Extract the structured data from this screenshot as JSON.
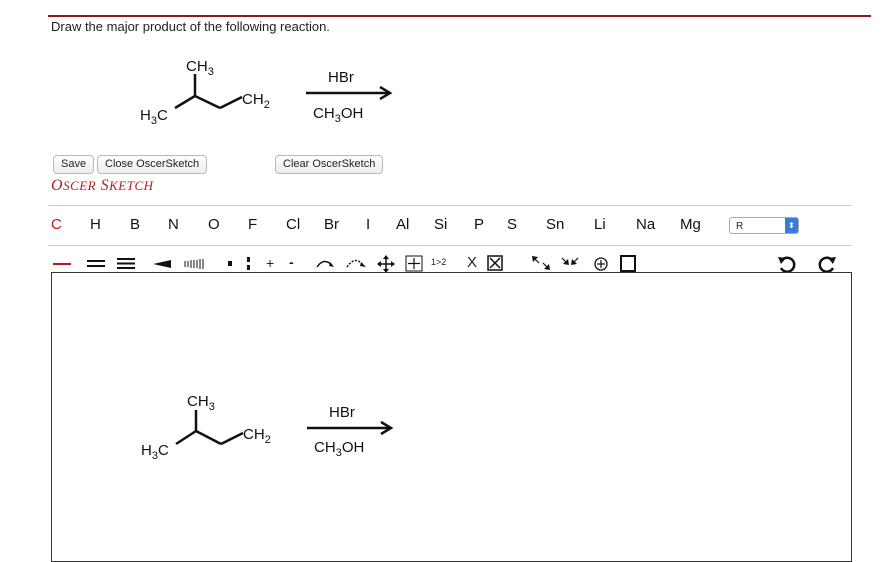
{
  "question": "Draw the major product of the following reaction.",
  "reaction": {
    "top_methyl": "CH3",
    "left_methyl": "H3C",
    "alkene_carbon": "CH2",
    "reagent_top": "HBr",
    "reagent_bottom": "CH3OH"
  },
  "buttons": {
    "save": "Save",
    "close": "Close OscerSketch",
    "clear": "Clear OscerSketch"
  },
  "brand": {
    "first_letter": "O",
    "first_rest": "SCER",
    "second_letter": "S",
    "second_rest": "KETCH"
  },
  "elements": [
    "C",
    "H",
    "B",
    "N",
    "O",
    "F",
    "Cl",
    "Br",
    "I",
    "Al",
    "Si",
    "P",
    "S",
    "Sn",
    "Li",
    "Na",
    "Mg"
  ],
  "selected_element": "C",
  "r_group_select": "R",
  "toolbar": {
    "charge_plus": "+",
    "charge_minus": "-",
    "atom_map": "1>2",
    "delete": "X"
  },
  "colors": {
    "accent": "#c0141a",
    "divider": "#8b1a1a",
    "select_arrow": "#3a7bd5"
  }
}
